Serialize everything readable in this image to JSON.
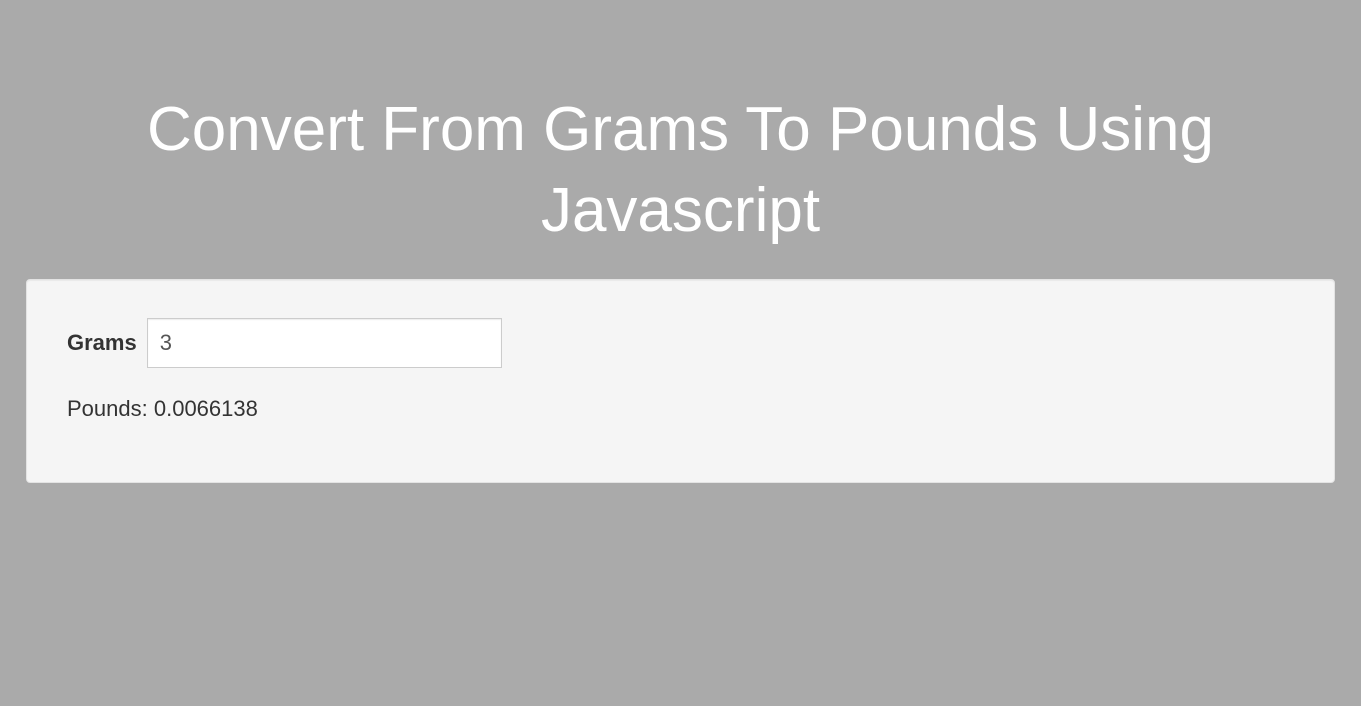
{
  "page": {
    "title": "Convert From Grams To Pounds Using Javascript"
  },
  "form": {
    "grams_label": "Grams",
    "grams_value": "3",
    "output_label": "Pounds:",
    "output_value": "0.0066138"
  }
}
